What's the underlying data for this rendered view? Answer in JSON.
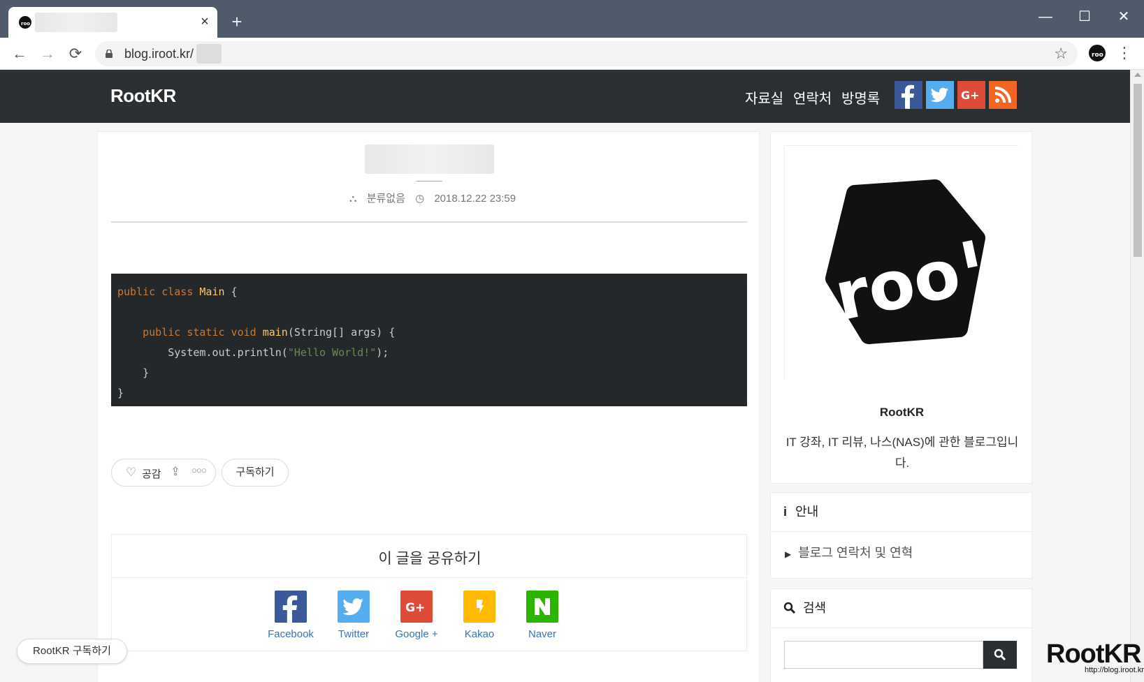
{
  "browser": {
    "url": "blog.iroot.kr/",
    "new_tab_label": "+",
    "close_label": "×",
    "window_controls": {
      "minimize": "—",
      "maximize": "☐",
      "close": "✕"
    }
  },
  "site": {
    "logo": "RootKR",
    "menu": [
      "자료실",
      "연락처",
      "방명록"
    ],
    "social_colors": {
      "facebook": "#3b5998",
      "twitter": "#55acee",
      "google": "#dd4b39",
      "rss": "#f26522"
    }
  },
  "post": {
    "category": "분류없음",
    "date": "2018.12.22 23:59",
    "code": {
      "l1_kw": "public class",
      "l1_cls": "Main",
      "l1_rest": " {",
      "l2_kw": "public static void",
      "l2_fn": "main",
      "l2_rest": "(String[] args) {",
      "l3_pre": "System.out.println(",
      "l3_str": "\"Hello World!\"",
      "l3_post": ");",
      "l4": "}",
      "l5": "}"
    },
    "like_label": "공감",
    "subscribe_label": "구독하기"
  },
  "share": {
    "title": "이 글을 공유하기",
    "items": [
      {
        "label": "Facebook",
        "color": "#3b5998"
      },
      {
        "label": "Twitter",
        "color": "#55acee"
      },
      {
        "label": "Google +",
        "color": "#dd4b39"
      },
      {
        "label": "Kakao",
        "color": "#ffb900"
      },
      {
        "label": "Naver",
        "color": "#2db400"
      }
    ]
  },
  "sidebar": {
    "profile_name": "RootKR",
    "profile_desc": "IT 강좌, IT 리뷰, 나스(NAS)에 관한 블로그입니다.",
    "notice_title": "안내",
    "notice_link": "블로그 연락처 및 연혁",
    "search_title": "검색"
  },
  "floating": {
    "subscribe": "RootKR 구독하기"
  },
  "watermark": {
    "big": "RootKR",
    "small": "http://blog.iroot.kr"
  }
}
